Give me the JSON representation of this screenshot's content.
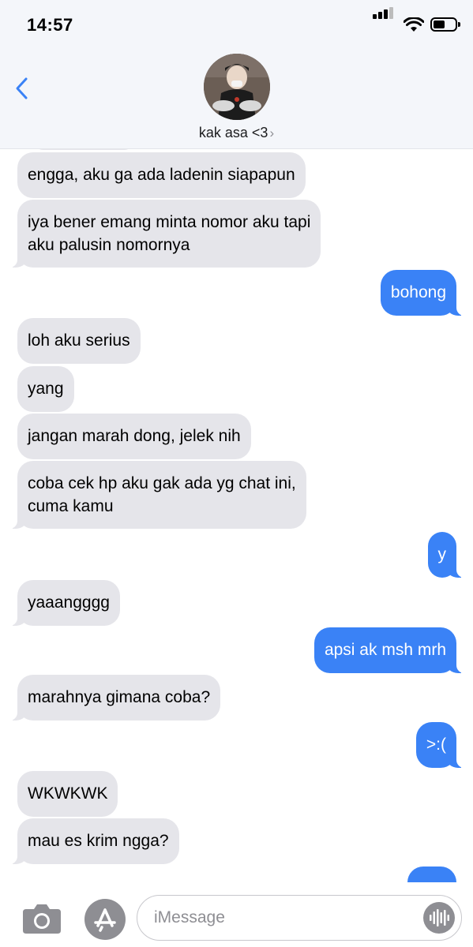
{
  "status_bar": {
    "time": "14:57",
    "battery_level": 0.55
  },
  "header": {
    "back_icon": "chevron-left-icon",
    "contact_name": "kak asa <3",
    "contact_chevron": "›",
    "accent_color": "#3a82f6"
  },
  "messages": [
    {
      "from": "them",
      "text": ""
    },
    {
      "from": "them",
      "text": "engga, aku ga ada ladenin siapapun"
    },
    {
      "from": "them",
      "lines": [
        "iya bener emang minta nomor aku tapi",
        "aku palusin nomornya"
      ]
    },
    {
      "from": "me",
      "text": "bohong"
    },
    {
      "from": "them",
      "text": "loh aku serius"
    },
    {
      "from": "them",
      "text": "yang"
    },
    {
      "from": "them",
      "text": "jangan marah dong, jelek nih"
    },
    {
      "from": "them",
      "lines": [
        "coba cek hp aku gak ada yg chat ini,",
        "cuma kamu"
      ]
    },
    {
      "from": "me",
      "text": "y"
    },
    {
      "from": "them",
      "text": "yaaangggg"
    },
    {
      "from": "me",
      "text": "apsi ak msh mrh"
    },
    {
      "from": "them",
      "text": "marahnya gimana coba?"
    },
    {
      "from": "me",
      "text": ">:("
    },
    {
      "from": "them",
      "text": "WKWKWK"
    },
    {
      "from": "them",
      "text": "mau es krim ngga?"
    },
    {
      "from": "me",
      "text": ""
    }
  ],
  "composer": {
    "placeholder": "iMessage",
    "camera_icon": "camera-icon",
    "apps_icon": "app-store-icon",
    "audio_icon": "audio-waveform-icon"
  },
  "colors": {
    "incoming": "#e5e5ea",
    "outgoing": "#3a82f6"
  }
}
